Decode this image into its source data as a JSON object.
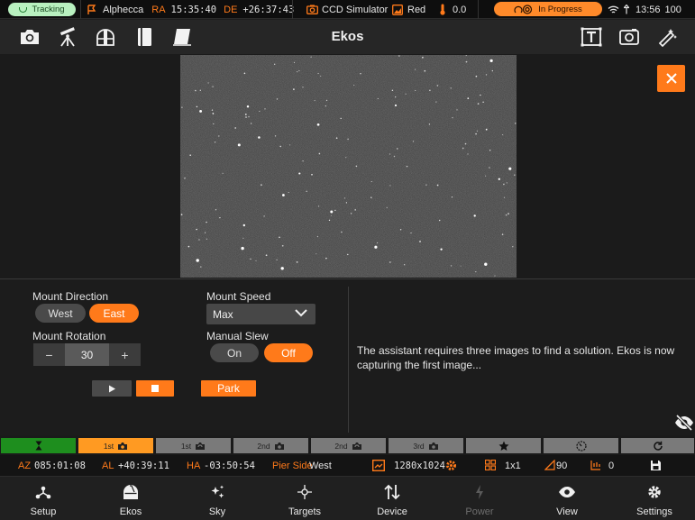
{
  "status_bar": {
    "tracking": "Tracking",
    "target_name": "Alphecca",
    "ra_label": "RA",
    "ra_value": "15:35:40",
    "de_label": "DE",
    "de_value": "+26:37:43",
    "camera": "CCD Simulator",
    "filter": "Red",
    "temperature": "0.0",
    "progress": "In Progress",
    "clock": "13:56",
    "battery": "100"
  },
  "toolbar": {
    "title": "Ekos",
    "left_icons": [
      "camera-icon",
      "mount-icon",
      "dome-icon",
      "notebook-icon",
      "flat-panel-icon"
    ],
    "right_icons": [
      "text-frame-icon",
      "capture-frame-icon",
      "wand-icon"
    ]
  },
  "controls": {
    "mount_direction_label": "Mount Direction",
    "west_label": "West",
    "east_label": "East",
    "mount_speed_label": "Mount Speed",
    "mount_speed_value": "Max",
    "mount_rotation_label": "Mount Rotation",
    "rotation_minus": "−",
    "rotation_value": "30",
    "rotation_plus": "+",
    "manual_slew_label": "Manual Slew",
    "on_label": "On",
    "off_label": "Off",
    "park_label": "Park",
    "message": "The assistant requires three images to find a solution. Ekos is now capturing the first image..."
  },
  "sequence": {
    "first_capture": "1st",
    "first_solve": "1st",
    "second_capture": "2nd",
    "second_solve": "2nd",
    "third_capture": "3rd"
  },
  "coords": {
    "az_label": "AZ",
    "az_value": "085:01:08",
    "al_label": "AL",
    "al_value": "+40:39:11",
    "ha_label": "HA",
    "ha_value": "-03:50:54",
    "pier_label": "Pier Side",
    "pier_value": "West",
    "resolution": "1280x1024",
    "binning": "1x1",
    "gain": "90",
    "offset": "0"
  },
  "bottom_nav": [
    {
      "label": "Setup",
      "icon": "setup-icon"
    },
    {
      "label": "Ekos",
      "icon": "ekos-icon"
    },
    {
      "label": "Sky",
      "icon": "sky-icon"
    },
    {
      "label": "Targets",
      "icon": "targets-icon"
    },
    {
      "label": "Device",
      "icon": "device-icon"
    },
    {
      "label": "Power",
      "icon": "power-icon"
    },
    {
      "label": "View",
      "icon": "view-icon"
    },
    {
      "label": "Settings",
      "icon": "settings-icon"
    }
  ],
  "colors": {
    "accent": "#ff7a1a",
    "tracking_bg": "#b8f0bf",
    "progress_bg": "#ff8a2a",
    "active_green": "#1e8e1e"
  }
}
